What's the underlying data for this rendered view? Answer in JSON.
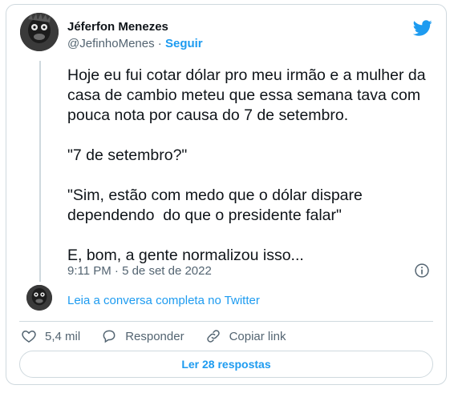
{
  "author": {
    "name": "Jéferfon Menezes",
    "handle": "@JefinhoMenes",
    "separator": "·",
    "follow_label": "Seguir"
  },
  "tweet": {
    "text": "Hoje eu fui cotar dólar pro meu irmão e a mulher da casa de cambio meteu que essa semana tava com pouca nota por causa do 7 de setembro.\n\n\"7 de setembro?\"\n\n\"Sim, estão com medo que o dólar dispare dependendo  do que o presidente falar\"\n\nE, bom, a gente normalizou isso...",
    "timestamp": "9:11 PM · 5 de set de 2022"
  },
  "conversation_link": "Leia a conversa completa no Twitter",
  "actions": {
    "likes": "5,4 mil",
    "reply_label": "Responder",
    "copy_label": "Copiar link"
  },
  "replies_button": "Ler 28 respostas",
  "icons": [
    "twitter-logo",
    "info-icon",
    "heart-icon",
    "reply-icon",
    "link-icon"
  ],
  "colors": {
    "accent": "#1d9bf0",
    "muted": "#536471",
    "border": "#cfd9de"
  }
}
